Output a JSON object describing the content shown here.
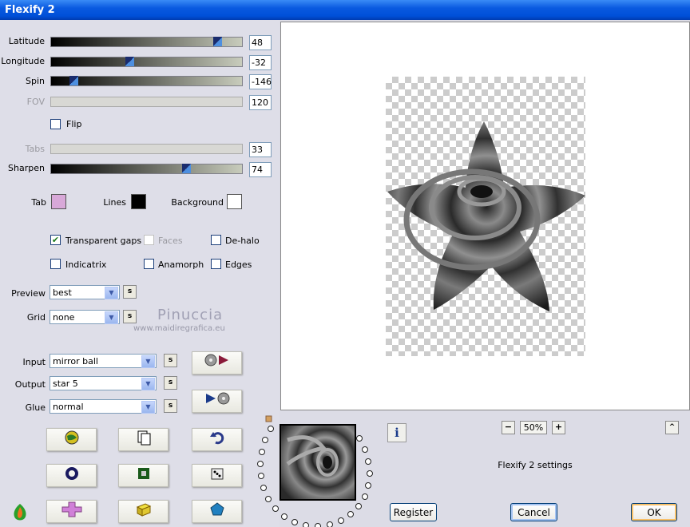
{
  "window": {
    "title": "Flexify 2"
  },
  "sliders": [
    {
      "label": "Latitude",
      "value": "48",
      "fraction": 0.89,
      "enabled": true
    },
    {
      "label": "Longitude",
      "value": "-32",
      "fraction": 0.41,
      "enabled": true
    },
    {
      "label": "Spin",
      "value": "-146",
      "fraction": 0.1,
      "enabled": true
    },
    {
      "label": "FOV",
      "value": "120",
      "fraction": null,
      "enabled": false
    },
    {
      "label": "Tabs",
      "value": "33",
      "fraction": null,
      "enabled": false
    },
    {
      "label": "Sharpen",
      "value": "74",
      "fraction": 0.72,
      "enabled": true
    }
  ],
  "flip": {
    "label": "Flip",
    "checked": false
  },
  "colors": {
    "tab": {
      "label": "Tab",
      "color": "#d8a8d8"
    },
    "lines": {
      "label": "Lines",
      "color": "#000000"
    },
    "background": {
      "label": "Background",
      "color": "#ffffff"
    }
  },
  "options": [
    {
      "label": "Transparent gaps",
      "checked": true,
      "enabled": true
    },
    {
      "label": "Faces",
      "checked": false,
      "enabled": false
    },
    {
      "label": "De-halo",
      "checked": false,
      "enabled": true
    },
    {
      "label": "Indicatrix",
      "checked": false,
      "enabled": true
    },
    {
      "label": "Anamorph",
      "checked": false,
      "enabled": true
    },
    {
      "label": "Edges",
      "checked": false,
      "enabled": true
    }
  ],
  "preview_select": {
    "label": "Preview",
    "value": "best"
  },
  "grid_select": {
    "label": "Grid",
    "value": "none"
  },
  "watermark": {
    "name": "Pinuccia",
    "url": "www.maidiregrafica.eu"
  },
  "input_select": {
    "label": "Input",
    "value": "mirror ball"
  },
  "output_select": {
    "label": "Output",
    "value": "star 5"
  },
  "glue_select": {
    "label": "Glue",
    "value": "normal"
  },
  "s_label": "s",
  "zoom": {
    "value": "50%",
    "minus": "−",
    "plus": "+"
  },
  "collapse_label": "^",
  "settings_name": "Flexify 2 settings",
  "info_label": "i",
  "buttons": {
    "register": "Register",
    "cancel": "Cancel",
    "ok": "OK"
  }
}
